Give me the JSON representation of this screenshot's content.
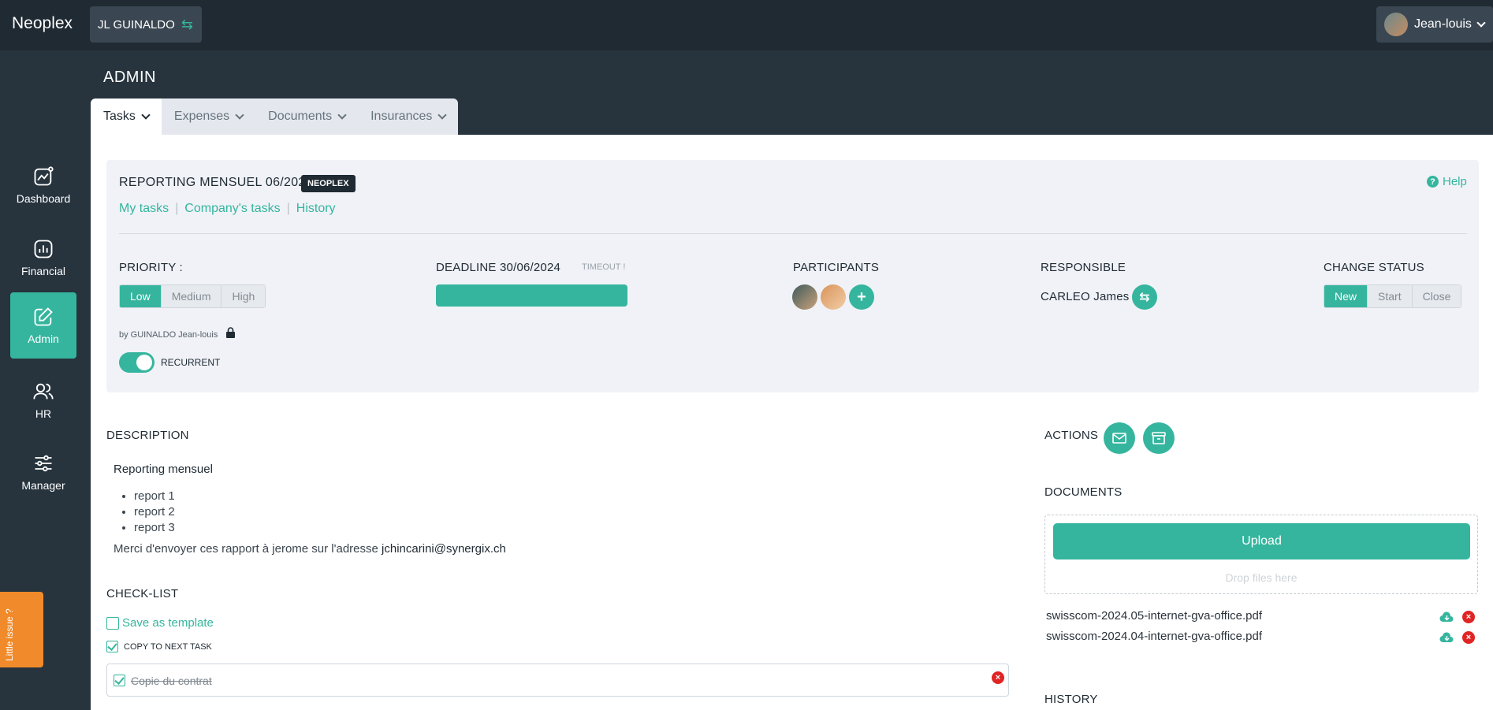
{
  "app": {
    "logo": "Neoplex"
  },
  "company": {
    "name": "JL GUINALDO"
  },
  "user": {
    "name": "Jean-louis"
  },
  "page": {
    "title": "ADMIN"
  },
  "tabs": [
    {
      "label": "Tasks"
    },
    {
      "label": "Expenses"
    },
    {
      "label": "Documents"
    },
    {
      "label": "Insurances"
    }
  ],
  "sidebar": {
    "items": [
      {
        "label": "Dashboard",
        "icon": "dashboard-icon"
      },
      {
        "label": "Financial",
        "icon": "financial-icon"
      },
      {
        "label": "Admin",
        "icon": "edit-icon",
        "active": true
      },
      {
        "label": "HR",
        "icon": "users-icon"
      },
      {
        "label": "Manager",
        "icon": "sliders-icon"
      }
    ]
  },
  "issue_tab": {
    "label": "Little issue ?"
  },
  "task": {
    "title": "REPORTING MENSUEL 06/2024",
    "badge": "NEOPLEX",
    "help": "Help",
    "subnav": [
      "My tasks",
      "Company's tasks",
      "History"
    ],
    "priority": {
      "label": "PRIORITY :",
      "options": [
        "Low",
        "Medium",
        "High"
      ],
      "selected": "Low"
    },
    "deadline": {
      "label": "DEADLINE 30/06/2024",
      "status": "TIMEOUT !"
    },
    "participants": {
      "label": "PARTICIPANTS"
    },
    "responsible": {
      "label": "RESPONSIBLE",
      "name": "CARLEO James"
    },
    "change_status": {
      "label": "CHANGE STATUS",
      "options": [
        "New",
        "Start",
        "Close"
      ],
      "selected": "New"
    },
    "author": "by GUINALDO Jean-louis",
    "recurrent": {
      "label": "RECURRENT",
      "on": true
    }
  },
  "description": {
    "heading": "DESCRIPTION",
    "title": "Reporting mensuel",
    "items": [
      "report 1",
      "report 2",
      "report 3"
    ],
    "text": "Merci d'envoyer ces rapport à jerome sur l'adresse ",
    "email": "jchincarini@synergix.ch"
  },
  "checklist": {
    "heading": "CHECK-LIST",
    "save_template": "Save as template",
    "copy_next": "COPY TO NEXT TASK",
    "items": [
      {
        "text": "Copie du contrat",
        "done": true
      }
    ]
  },
  "actions": {
    "heading": "ACTIONS"
  },
  "documents": {
    "heading": "DOCUMENTS",
    "upload": "Upload",
    "drop_hint": "Drop files here",
    "files": [
      "swisscom-2024.05-internet-gva-office.pdf",
      "swisscom-2024.04-internet-gva-office.pdf"
    ]
  },
  "history": {
    "heading": "HISTORY"
  },
  "colors": {
    "accent": "#35b59e",
    "dark": "#1f2a33",
    "danger": "#e02424",
    "issue": "#f08a2a"
  }
}
